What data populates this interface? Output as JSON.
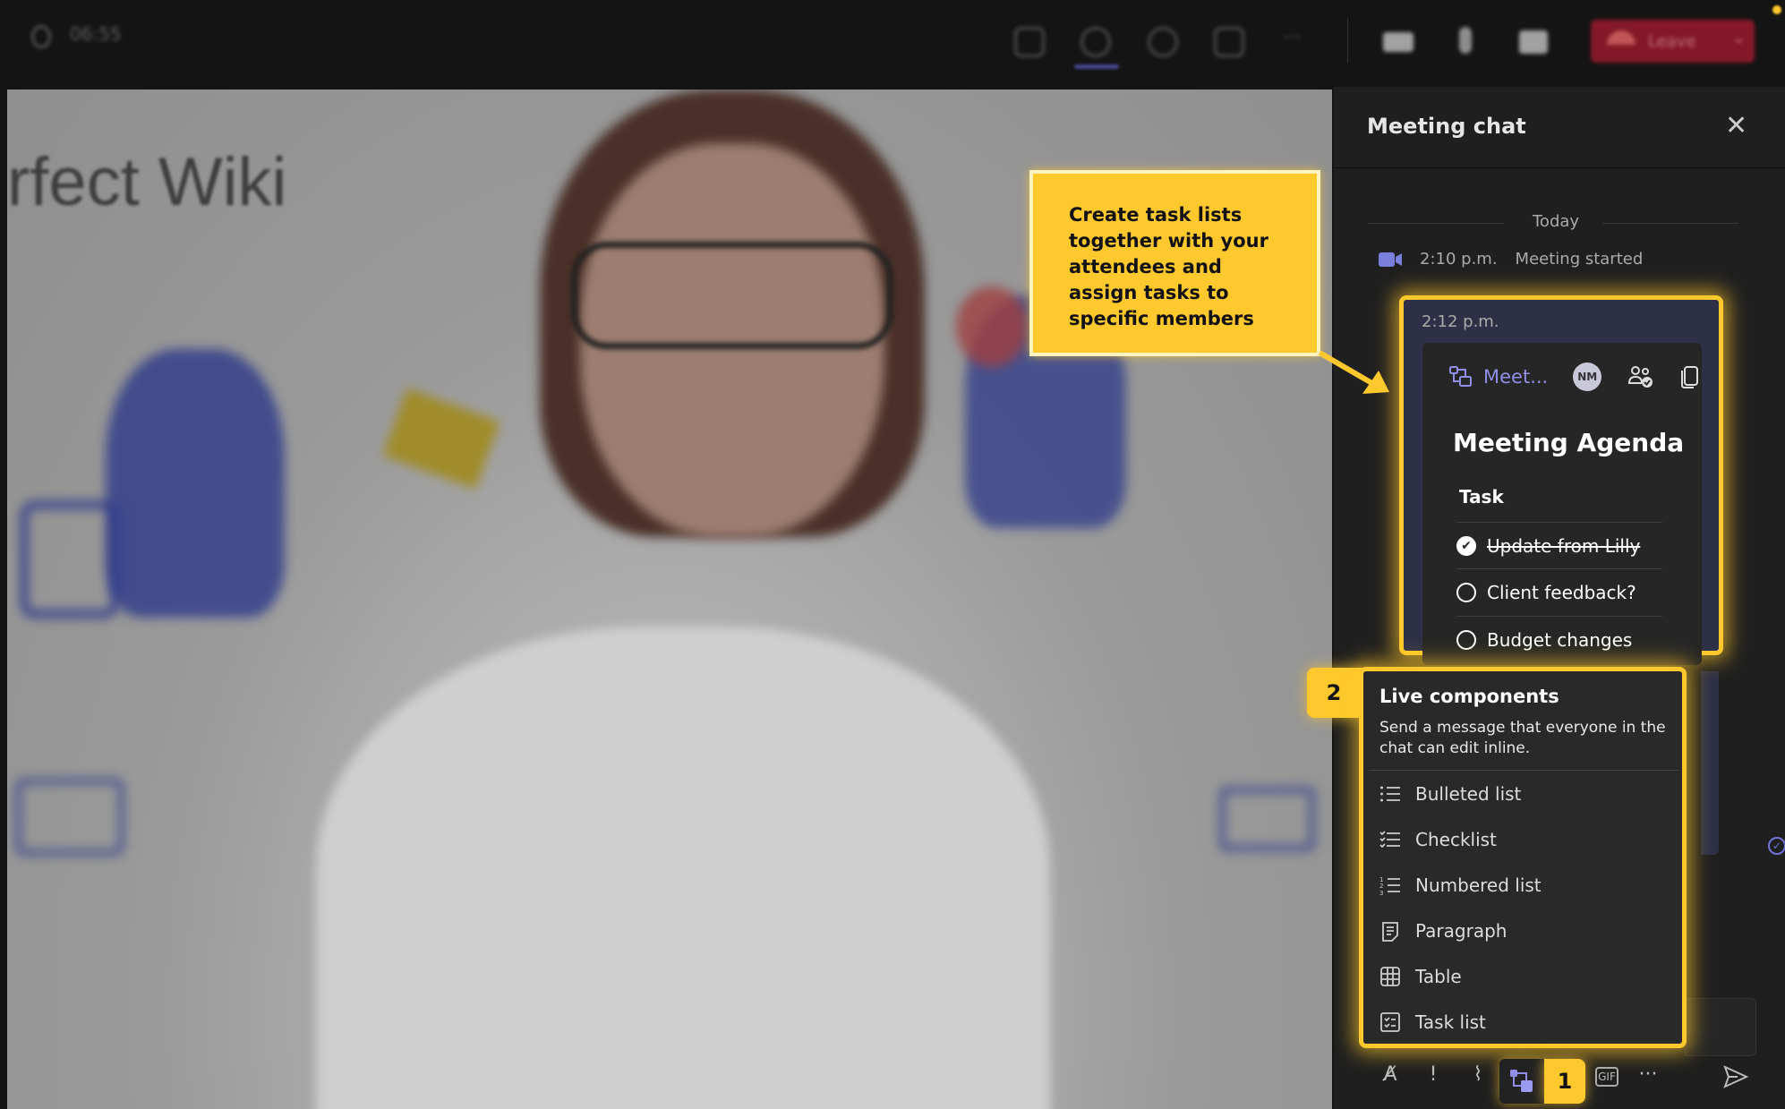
{
  "topbar": {
    "time": "06:55",
    "leave_label": "Leave",
    "icons": [
      "shield-icon",
      "people-icon",
      "chat-icon",
      "reactions-icon",
      "share-icon",
      "more-icon",
      "camera-icon",
      "mic-icon",
      "share-screen-icon",
      "phone-icon",
      "chevron-down-icon"
    ]
  },
  "video": {
    "background_text": "rfect Wiki"
  },
  "panel": {
    "title": "Meeting chat",
    "date_divider": "Today",
    "system_event": {
      "time": "2:10 p.m.",
      "text": "Meeting started"
    },
    "message": {
      "time": "2:12 p.m.",
      "component_name": "Meet...",
      "avatar_initials": "NM",
      "title": "Meeting Agenda",
      "column_header": "Task",
      "tasks": [
        {
          "label": "Update from Lilly",
          "done": true
        },
        {
          "label": "Client feedback?",
          "done": false
        },
        {
          "label": "Budget changes",
          "done": false
        }
      ]
    }
  },
  "callout": {
    "text": "Create task lists together with your attendees and assign tasks to specific members",
    "color": "#ffc82c"
  },
  "menu": {
    "step_badge": "2",
    "title": "Live components",
    "description": "Send a message that everyone in the chat can edit inline.",
    "items": [
      {
        "label": "Bulleted list",
        "icon": "bulleted-list-icon"
      },
      {
        "label": "Checklist",
        "icon": "checklist-icon"
      },
      {
        "label": "Numbered list",
        "icon": "numbered-list-icon"
      },
      {
        "label": "Paragraph",
        "icon": "paragraph-icon"
      },
      {
        "label": "Table",
        "icon": "table-icon"
      },
      {
        "label": "Task list",
        "icon": "task-list-icon"
      }
    ]
  },
  "toolbar": {
    "step_badge": "1",
    "gif_label": "GIF",
    "more_label": "···"
  }
}
